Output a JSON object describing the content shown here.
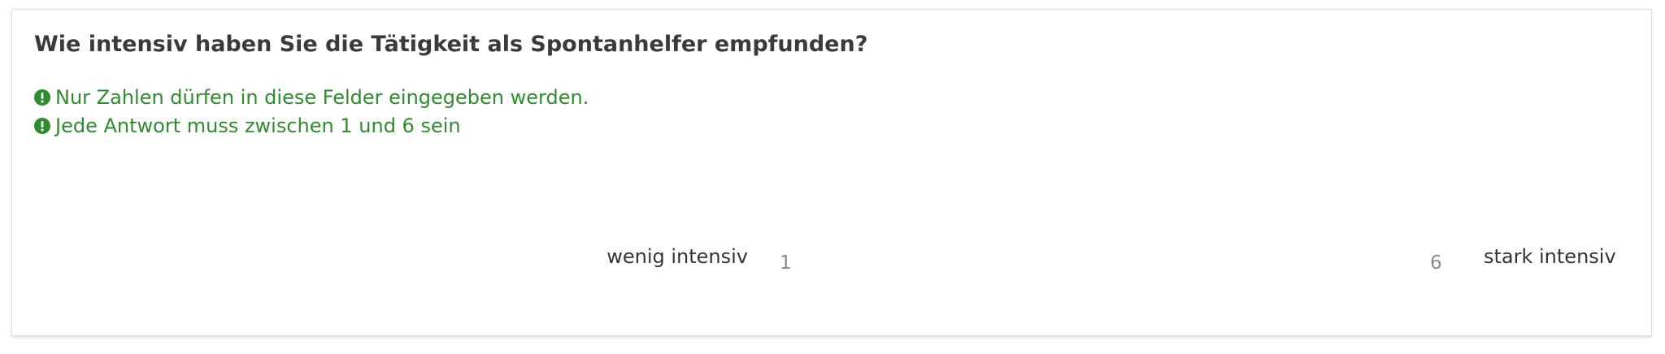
{
  "question": {
    "title": "Wie intensiv haben Sie die Tätigkeit als Spontanhelfer empfunden?"
  },
  "validation": {
    "color": "#2e8b2e",
    "icon": "exclamation-circle-icon",
    "messages": [
      "Nur Zahlen dürfen in diese Felder eingegeben werden.",
      "Jede Antwort muss zwischen 1 und 6 sein"
    ]
  },
  "scale": {
    "left_label": "wenig intensiv",
    "right_label": "stark intensiv",
    "min": "1",
    "max": "6"
  }
}
